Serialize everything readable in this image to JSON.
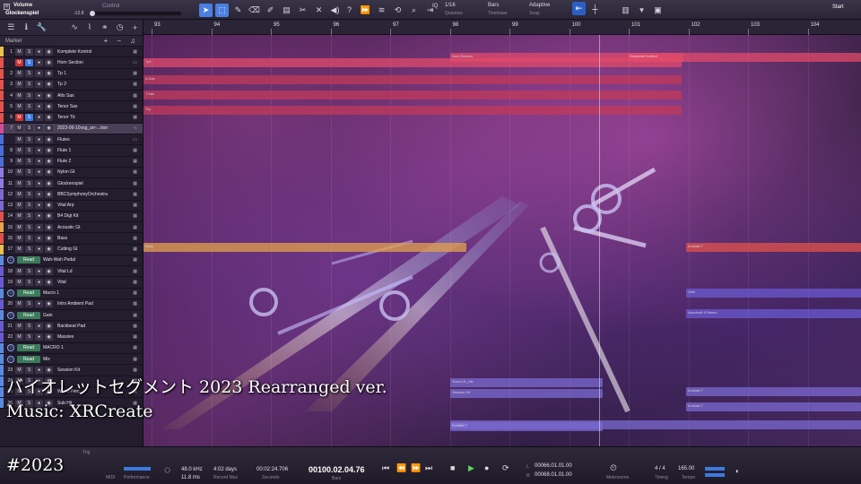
{
  "toolbar": {
    "parameter": "Volume",
    "track": "Glockenspiel",
    "value": "-12.8",
    "control_label": "Control",
    "quantize_value": "1/16",
    "quantize_label": "Quantize",
    "timebase_value": "Bars",
    "timebase_label": "Timebase",
    "snap_value": "Adaptive",
    "snap_label": "Snap",
    "start_label": "Start"
  },
  "tracklist": {
    "marker_label": "Marker",
    "tracks": [
      {
        "num": "1",
        "name": "Komplete Kontrol",
        "color": "#e8c24a",
        "type": "inst"
      },
      {
        "num": "",
        "name": "Horn Section",
        "color": "#e2524a",
        "type": "folder",
        "mute": true,
        "solo": true
      },
      {
        "num": "2",
        "name": "Tp 1",
        "color": "#e2524a",
        "type": "inst"
      },
      {
        "num": "3",
        "name": "Tp 2",
        "color": "#e2524a",
        "type": "inst"
      },
      {
        "num": "4",
        "name": "Alto Sax",
        "color": "#e2524a",
        "type": "inst"
      },
      {
        "num": "5",
        "name": "Tenor Sax",
        "color": "#e2524a",
        "type": "inst"
      },
      {
        "num": "6",
        "name": "Tenor Tb",
        "color": "#e2524a",
        "type": "inst",
        "mute": true,
        "solo": true
      },
      {
        "num": "7",
        "name": "2023-06-10vsg_arr-...tion",
        "color": "#d24c9a",
        "type": "audio",
        "selected": true
      },
      {
        "num": "",
        "name": "Flutes",
        "color": "#4a6ed8",
        "type": "folder"
      },
      {
        "num": "8",
        "name": "Flute 1",
        "color": "#4a6ed8",
        "type": "inst"
      },
      {
        "num": "9",
        "name": "Flute 2",
        "color": "#4a6ed8",
        "type": "inst"
      },
      {
        "num": "10",
        "name": "Nylon Gt",
        "color": "#8f7ae0",
        "type": "inst"
      },
      {
        "num": "11",
        "name": "Glockenspiel",
        "color": "#8f7ae0",
        "type": "inst"
      },
      {
        "num": "12",
        "name": "BBCSymphonyOrchestra",
        "color": "#7a6ad0",
        "type": "inst"
      },
      {
        "num": "13",
        "name": "Vital Arp",
        "color": "#7a6ad0",
        "type": "inst"
      },
      {
        "num": "14",
        "name": "B4 Digi Kit",
        "color": "#e2524a",
        "type": "inst"
      },
      {
        "num": "15",
        "name": "Acoustic Gt",
        "color": "#e8a24a",
        "type": "inst"
      },
      {
        "num": "16",
        "name": "Bass",
        "color": "#e2524a",
        "type": "inst"
      },
      {
        "num": "17",
        "name": "Cutting Gt",
        "color": "#e8c24a",
        "type": "inst"
      },
      {
        "num": "",
        "name": "Wah-Wah Pedal",
        "color": "#5a8ae0",
        "type": "auto",
        "read": "Read"
      },
      {
        "num": "18",
        "name": "Vital Ld",
        "color": "#6a5ad0",
        "type": "inst"
      },
      {
        "num": "19",
        "name": "Vital",
        "color": "#6a5ad0",
        "type": "inst"
      },
      {
        "num": "",
        "name": "Macro 1",
        "color": "#5a8ae0",
        "type": "auto",
        "read": "Read"
      },
      {
        "num": "20",
        "name": "Intro Ambient Pad",
        "color": "#6a5ad0",
        "type": "inst"
      },
      {
        "num": "",
        "name": "Gain",
        "color": "#5a8ae0",
        "type": "auto",
        "read": "Read"
      },
      {
        "num": "21",
        "name": "Backbeat Pad",
        "color": "#6a5ad0",
        "type": "inst"
      },
      {
        "num": "22",
        "name": "Massive",
        "color": "#6a5ad0",
        "type": "inst"
      },
      {
        "num": "",
        "name": "MACRO 1",
        "color": "#5a8ae0",
        "type": "auto",
        "read": "Read"
      },
      {
        "num": "",
        "name": "Mix",
        "color": "#5a8ae0",
        "type": "auto",
        "read": "Read"
      },
      {
        "num": "23",
        "name": "Session Kit",
        "color": "#5a8ae0",
        "type": "inst"
      },
      {
        "num": "24",
        "name": "",
        "color": "#5a8ae0",
        "type": "inst"
      },
      {
        "num": "25",
        "name": "Wood Perc",
        "color": "#5a8ae0",
        "type": "inst"
      },
      {
        "num": "26",
        "name": "Sub Hit",
        "color": "#5a8ae0",
        "type": "inst"
      }
    ],
    "bottom_label": "Trig"
  },
  "ruler": {
    "bars": [
      "93",
      "94",
      "95",
      "96",
      "97",
      "98",
      "99",
      "100",
      "101",
      "102",
      "103",
      "104"
    ]
  },
  "clips": [
    {
      "name": "Horn Section",
      "color": "#e24a6a"
    },
    {
      "name": "Komplete Kontrol",
      "color": "#e24a6a"
    },
    {
      "name": "Tp1",
      "color": "#e24a6a"
    },
    {
      "name": "A.Sax",
      "color": "#c23a5a"
    },
    {
      "name": "T.Sax",
      "color": "#c23a5a"
    },
    {
      "name": "Trp",
      "color": "#c23a5a"
    },
    {
      "name": "Bass",
      "color": "#e2a24a"
    },
    {
      "name": "Kontakt 7",
      "color": "#e2524a"
    },
    {
      "name": "Vital",
      "color": "#6a5ad0"
    },
    {
      "name": "Abschnitt 9 Stereo",
      "color": "#6a5ad0"
    },
    {
      "name": "Kontakt 7",
      "color": "#7a6ad0"
    },
    {
      "name": "Kontakt 7",
      "color": "#7a6ad0"
    },
    {
      "name": "Kontakt 7",
      "color": "#7a6ad0"
    },
    {
      "name": "Sound.D_Uki",
      "color": "#7a6ad0"
    },
    {
      "name": "Session Kit",
      "color": "#7a6ad0"
    },
    {
      "name": "Kontakt 7",
      "color": "#7a6ad0"
    }
  ],
  "overlay": {
    "title": "バイオレットセグメント 2023 Rearranged ver.",
    "music": "Music: XRCreate",
    "year": "#2023"
  },
  "transport": {
    "midi_label": "MIDI",
    "performance_label": "Performance",
    "sample_rate": "48.0 kHz",
    "latency": "11.8 ms",
    "record_days": "4:02 days",
    "record_label": "Record Max",
    "seconds": "00:02:24.706",
    "seconds_label": "Seconds",
    "bars_value": "00100.02.04.76",
    "bars_label": "Bars",
    "loop_left": "00066.01.01.00",
    "loop_right": "00068.01.01.00",
    "loop_l_label": "L",
    "loop_r_label": "R",
    "metronome_label": "Metronome",
    "time_sig": "4 / 4",
    "timing_label": "Timing",
    "tempo": "165.00",
    "tempo_label": "Tempo"
  }
}
